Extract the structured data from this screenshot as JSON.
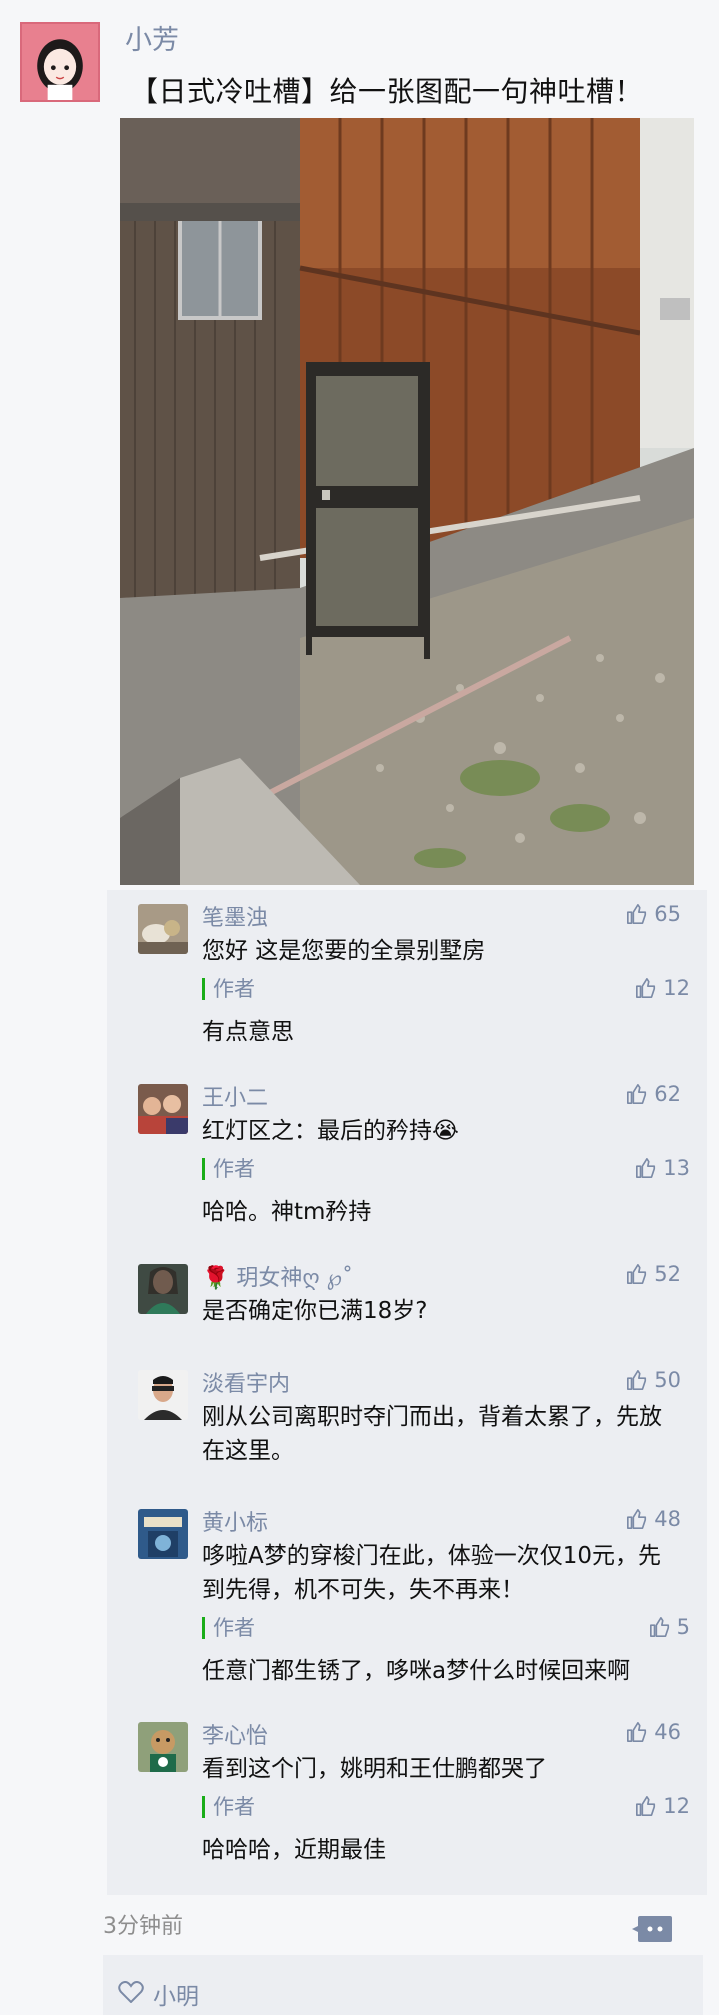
{
  "post": {
    "author": "小芳",
    "text": "【日式冷吐槽】给一张图配一句神吐槽！",
    "time": "3分钟前"
  },
  "comments": [
    {
      "name": "笔墨浊",
      "text": "您好 这是您要的全景别墅房",
      "likes": "65",
      "reply": {
        "label": "作者",
        "text": "有点意思",
        "likes": "12"
      }
    },
    {
      "name": "王小二",
      "text": "红灯区之：最后的矜持😭",
      "likes": "62",
      "reply": {
        "label": "作者",
        "text": "哈哈。神tm矜持",
        "likes": "13"
      }
    },
    {
      "name": "🌹 玥女神ღ ℘˚",
      "text": "是否确定你已满18岁?",
      "likes": "52"
    },
    {
      "name": "淡看宇内",
      "text": "刚从公司离职时夺门而出，背着太累了，先放在这里。",
      "likes": "50"
    },
    {
      "name": "黄小标",
      "text": "哆啦A梦的穿梭门在此，体验一次仅10元，先到先得，机不可失，失不再来！",
      "likes": "48",
      "reply": {
        "label": "作者",
        "text": "任意门都生锈了，哆咪a梦什么时候回来啊",
        "likes": "5"
      }
    },
    {
      "name": "李心怡",
      "text": "看到这个门，姚明和王仕鹏都哭了",
      "likes": "46",
      "reply": {
        "label": "作者",
        "text": "哈哈哈，近期最佳",
        "likes": "12"
      }
    }
  ],
  "likes_bar": {
    "first_liker": "小明"
  },
  "colors": {
    "name_blue": "#7b8aa6",
    "author_bar_green": "#1aad19",
    "panel": "#eceef2"
  },
  "icons": [
    "thumbs-up-icon",
    "comment-icon",
    "heart-icon"
  ]
}
